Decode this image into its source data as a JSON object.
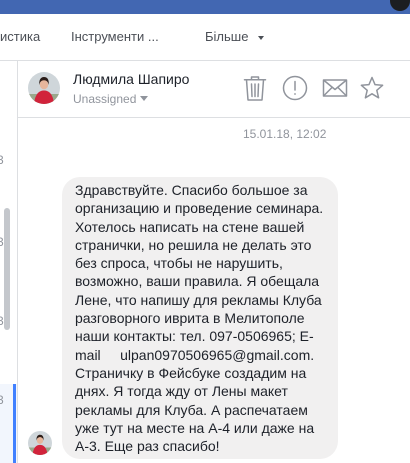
{
  "topbar": {
    "profile_icon": "profile-avatar-icon"
  },
  "nav": {
    "items": [
      {
        "label": "истика"
      },
      {
        "label": "Інструменти ..."
      },
      {
        "label": "Більше"
      }
    ],
    "more_icon": "chevron-down-icon"
  },
  "conversation_list": {
    "items": [
      {
        "date_fragment": "3",
        "selected": false
      },
      {
        "date_fragment": "3",
        "selected": false
      },
      {
        "date_fragment": "3",
        "selected": false
      },
      {
        "date_fragment": "3",
        "selected": true
      }
    ]
  },
  "thread": {
    "contact": {
      "name": "Людмила Шапиро",
      "assignment": "Unassigned",
      "assignment_icon": "chevron-down-icon"
    },
    "actions": [
      {
        "icon": "trash-icon"
      },
      {
        "icon": "exclamation-circle-icon"
      },
      {
        "icon": "envelope-icon"
      },
      {
        "icon": "star-icon"
      }
    ],
    "timestamp": "15.01.18, 12:02",
    "message": {
      "lines": [
        "Здравствуйте. Спасибо большое за",
        "организацию и проведение семинара.",
        "Хотелось написать на стене вашей",
        "странички, но решила не делать это",
        "без спроса, чтобы не нарушить,",
        "возможно, ваши правила. Я обещала",
        "Лене, что напишу для рекламы Клуба",
        "разговорного иврита в Мелитополе",
        "наши контакты: тел. 097-0506965; E-",
        "mail     ulpan0970506965@gmail.com.",
        "Страничку в Фейсбуке создадим на",
        "днях. Я тогда жду от Лены макет",
        "рекламы для Клуба. А распечатаем",
        "уже тут на месте на А-4 или даже на",
        "А-3. Еще раз спасибо!"
      ]
    }
  },
  "colors": {
    "brand": "#4267b2",
    "bubble": "#f1f0f0",
    "muted": "#90949c",
    "text": "#1d2129",
    "selected": "#4080ff"
  }
}
